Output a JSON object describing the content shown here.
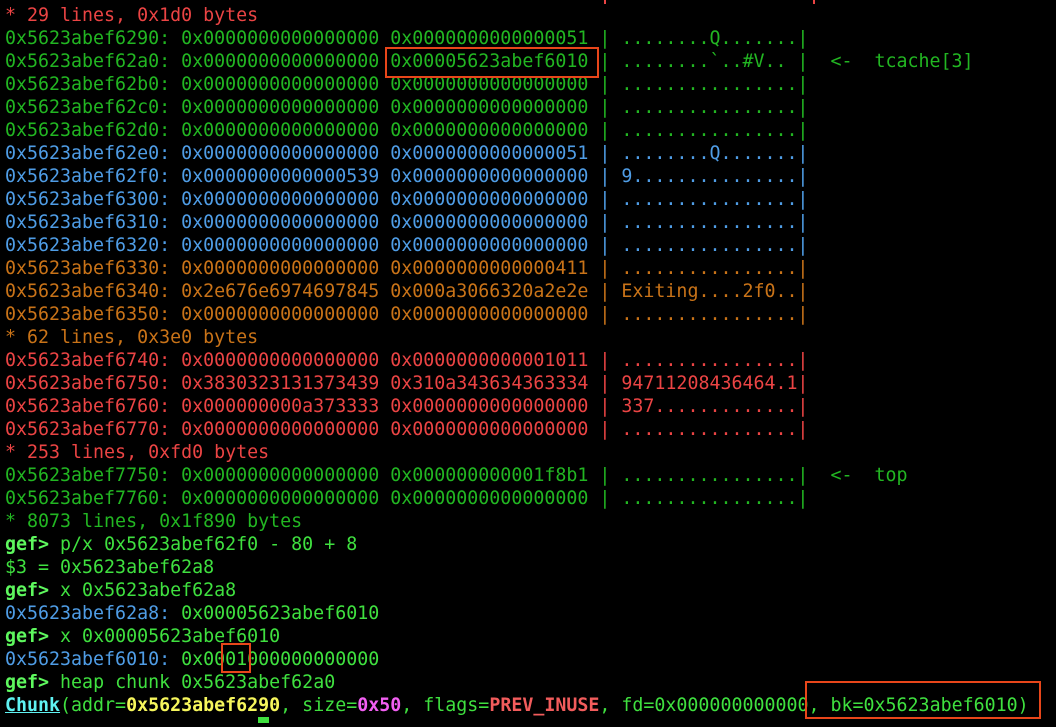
{
  "terminal": {
    "prompt": "gef>",
    "summary_lines": {
      "s29": "* 29 lines, 0x1d0 bytes",
      "s62": "* 62 lines, 0x3e0 bytes",
      "s253": "* 253 lines, 0xfd0 bytes",
      "s8073": "* 8073 lines, 0x1f890 bytes"
    },
    "hexdump": [
      {
        "addr": "0x5623abef6290:",
        "q1": "0x0000000000000000",
        "q2": "0x0000000000000051",
        "ascii": "........Q.......",
        "note": "",
        "color": "g"
      },
      {
        "addr": "0x5623abef62a0:",
        "q1": "0x0000000000000000",
        "q2": "0x00005623abef6010",
        "ascii": "........`..#V..",
        "note": "<-  tcache[3]",
        "color": "g"
      },
      {
        "addr": "0x5623abef62b0:",
        "q1": "0x0000000000000000",
        "q2": "0x0000000000000000",
        "ascii": "................",
        "note": "",
        "color": "g"
      },
      {
        "addr": "0x5623abef62c0:",
        "q1": "0x0000000000000000",
        "q2": "0x0000000000000000",
        "ascii": "................",
        "note": "",
        "color": "g"
      },
      {
        "addr": "0x5623abef62d0:",
        "q1": "0x0000000000000000",
        "q2": "0x0000000000000000",
        "ascii": "................",
        "note": "",
        "color": "g"
      },
      {
        "addr": "0x5623abef62e0:",
        "q1": "0x0000000000000000",
        "q2": "0x0000000000000051",
        "ascii": "........Q.......",
        "note": "",
        "color": "b"
      },
      {
        "addr": "0x5623abef62f0:",
        "q1": "0x0000000000000539",
        "q2": "0x0000000000000000",
        "ascii": "9...............",
        "note": "",
        "color": "b"
      },
      {
        "addr": "0x5623abef6300:",
        "q1": "0x0000000000000000",
        "q2": "0x0000000000000000",
        "ascii": "................",
        "note": "",
        "color": "b"
      },
      {
        "addr": "0x5623abef6310:",
        "q1": "0x0000000000000000",
        "q2": "0x0000000000000000",
        "ascii": "................",
        "note": "",
        "color": "b"
      },
      {
        "addr": "0x5623abef6320:",
        "q1": "0x0000000000000000",
        "q2": "0x0000000000000000",
        "ascii": "................",
        "note": "",
        "color": "b"
      },
      {
        "addr": "0x5623abef6330:",
        "q1": "0x0000000000000000",
        "q2": "0x0000000000000411",
        "ascii": "................",
        "note": "",
        "color": "o"
      },
      {
        "addr": "0x5623abef6340:",
        "q1": "0x2e676e6974697845",
        "q2": "0x000a3066320a2e2e",
        "ascii": "Exiting....2f0..",
        "note": "",
        "color": "o"
      },
      {
        "addr": "0x5623abef6350:",
        "q1": "0x0000000000000000",
        "q2": "0x0000000000000000",
        "ascii": "................",
        "note": "",
        "color": "o"
      },
      {
        "addr": "0x5623abef6740:",
        "q1": "0x0000000000000000",
        "q2": "0x0000000000001011",
        "ascii": "................",
        "note": "",
        "color": "r"
      },
      {
        "addr": "0x5623abef6750:",
        "q1": "0x3830323131373439",
        "q2": "0x310a343634363334",
        "ascii": "94711208436464.1",
        "note": "",
        "color": "r"
      },
      {
        "addr": "0x5623abef6760:",
        "q1": "0x000000000a373333",
        "q2": "0x0000000000000000",
        "ascii": "337.............",
        "note": "",
        "color": "r"
      },
      {
        "addr": "0x5623abef6770:",
        "q1": "0x0000000000000000",
        "q2": "0x0000000000000000",
        "ascii": "................",
        "note": "",
        "color": "r"
      },
      {
        "addr": "0x5623abef7750:",
        "q1": "0x0000000000000000",
        "q2": "0x000000000001f8b1",
        "ascii": "................",
        "note": "<-  top",
        "color": "g"
      },
      {
        "addr": "0x5623abef7760:",
        "q1": "0x0000000000000000",
        "q2": "0x0000000000000000",
        "ascii": "................",
        "note": "",
        "color": "g"
      }
    ],
    "commands": {
      "c1": "p/x 0x5623abef62f0 - 80 + 8",
      "c1_out": "$3 = 0x5623abef62a8",
      "c2": "x 0x5623abef62a8",
      "c2_addr": "0x5623abef62a8:",
      "c2_val": "0x00005623abef6010",
      "c3": "x 0x00005623abef6010",
      "c3_addr": "0x5623abef6010:",
      "c3_val_pre": "0x00",
      "c3_val_hl": "01",
      "c3_val_post": "000000000000",
      "c4": "heap chunk 0x5623abef62a0"
    },
    "chunk": {
      "label": "Chunk",
      "open": "(addr=",
      "addr": "0x5623abef6290",
      "size_key": ", size=",
      "size": "0x50",
      "flags_key": ", flags=",
      "flags": "PREV_INUSE",
      "fd": ", fd=0x000000000000",
      "bk": ", bk=0x5623abef6010)"
    },
    "colors": {
      "green": "#22b622",
      "blue": "#4f9de6",
      "orange": "#c97318",
      "red": "#eb4444",
      "highlight_box": "#e8461a"
    }
  }
}
